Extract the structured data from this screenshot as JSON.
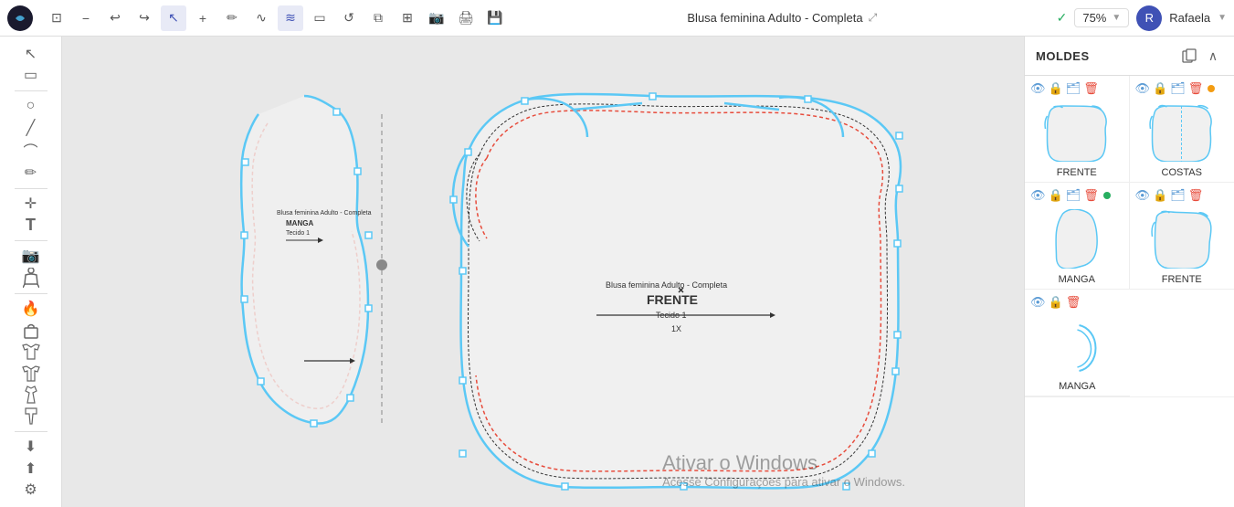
{
  "toolbar": {
    "title": "Blusa feminina Adulto - Completa",
    "zoom": "75%",
    "user": "Rafaela",
    "user_initial": "R",
    "check_icon": "✓",
    "expand_icon": "⤢"
  },
  "toolbar_buttons": [
    {
      "name": "logo",
      "label": ""
    },
    {
      "name": "zoom-fit",
      "label": "⊡"
    },
    {
      "name": "zoom-out",
      "label": "−"
    },
    {
      "name": "undo",
      "label": "↩"
    },
    {
      "name": "redo",
      "label": "↪"
    },
    {
      "name": "cursor",
      "label": "↖"
    },
    {
      "name": "add",
      "label": "+"
    },
    {
      "name": "pen",
      "label": "✏"
    },
    {
      "name": "curve",
      "label": "∿"
    },
    {
      "name": "zigzag",
      "label": "≋"
    },
    {
      "name": "rectangle",
      "label": "▭"
    },
    {
      "name": "refresh",
      "label": "↺"
    },
    {
      "name": "copy",
      "label": "⧉"
    },
    {
      "name": "layers",
      "label": "⊞"
    },
    {
      "name": "camera",
      "label": "📷"
    },
    {
      "name": "print",
      "label": "🖨"
    },
    {
      "name": "save",
      "label": "💾"
    }
  ],
  "sidebar_tools": [
    {
      "name": "select",
      "icon": "↖"
    },
    {
      "name": "square-select",
      "icon": "▭"
    },
    {
      "name": "circle-tool",
      "icon": "○"
    },
    {
      "name": "line-tool",
      "icon": "╱"
    },
    {
      "name": "curve-tool",
      "icon": "⌒"
    },
    {
      "name": "pencil-tool",
      "icon": "✏"
    },
    {
      "name": "crosshair",
      "icon": "✛"
    },
    {
      "name": "text-tool",
      "icon": "T"
    },
    {
      "name": "camera-tool",
      "icon": "📷"
    },
    {
      "name": "mannequin",
      "icon": "👤"
    },
    {
      "name": "fire-tool",
      "icon": "🔥"
    },
    {
      "name": "bag-tool",
      "icon": "👜"
    },
    {
      "name": "shirt1",
      "icon": "👕"
    },
    {
      "name": "shirt2",
      "icon": "👔"
    },
    {
      "name": "dress",
      "icon": "👗"
    },
    {
      "name": "pants",
      "icon": "👖"
    },
    {
      "name": "download",
      "icon": "⬇"
    },
    {
      "name": "upload",
      "icon": "⬆"
    },
    {
      "name": "settings",
      "icon": "⚙"
    }
  ],
  "canvas": {
    "background": "#e8e8e8",
    "pattern_title": "Blusa feminina Adulto - Completa",
    "pattern_piece_front": "FRENTE",
    "pattern_piece_sleeve": "MANGA",
    "pattern_piece_tecido": "Tecido 1",
    "pattern_piece_ix": "1X"
  },
  "right_panel": {
    "title": "MOLDES",
    "add_icon": "🗂",
    "close_icon": "∧",
    "moldes": [
      {
        "label": "FRENTE",
        "has_dot": false
      },
      {
        "label": "COSTAS",
        "has_dot": true
      },
      {
        "label": "MANGA",
        "has_dot": true
      },
      {
        "label": "FRENTE",
        "has_dot": false
      },
      {
        "label": "MANGA",
        "has_dot": false
      }
    ]
  },
  "activate_windows": {
    "title": "Ativar o Windows",
    "subtitle": "Acesse Configurações para ativar o Windows."
  }
}
